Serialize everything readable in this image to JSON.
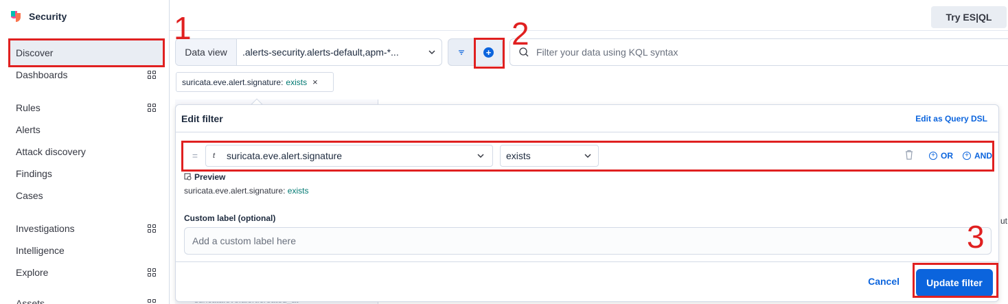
{
  "app": {
    "title": "Security"
  },
  "topbar": {
    "try_esql": "Try ES|QL"
  },
  "sidebar": {
    "items": [
      {
        "label": "Discover",
        "has_grid": false
      },
      {
        "label": "Dashboards",
        "has_grid": true
      },
      {
        "label": "Rules",
        "has_grid": true
      },
      {
        "label": "Alerts",
        "has_grid": false
      },
      {
        "label": "Attack discovery",
        "has_grid": false
      },
      {
        "label": "Findings",
        "has_grid": false
      },
      {
        "label": "Cases",
        "has_grid": false
      },
      {
        "label": "Investigations",
        "has_grid": true
      },
      {
        "label": "Intelligence",
        "has_grid": false
      },
      {
        "label": "Explore",
        "has_grid": true
      },
      {
        "label": "Assets",
        "has_grid": true
      }
    ]
  },
  "query_bar": {
    "data_view_label": "Data view",
    "data_view_value": ".alerts-security.alerts-default,apm-*...",
    "kql_placeholder": "Filter your data using KQL syntax"
  },
  "filter_pill": {
    "field": "suricata.eve.alert.signature:",
    "operator": "exists"
  },
  "edit_filter": {
    "title": "Edit filter",
    "edit_dsl": "Edit as Query DSL",
    "field_type": "t",
    "field": "suricata.eve.alert.signature",
    "operator": "exists",
    "or_label": "OR",
    "and_label": "AND",
    "preview_title": "Preview",
    "preview_field": "suricata.eve.alert.signature:",
    "preview_operator": "exists",
    "custom_label_caption": "Custom label (optional)",
    "custom_label_placeholder": "Add a custom label here",
    "cancel": "Cancel",
    "update": "Update filter"
  },
  "background": {
    "partial_field": "suricata.eve.alert.created_at",
    "partial_right": "ut"
  },
  "annotations": [
    "1",
    "2",
    "3"
  ],
  "colors": {
    "accent": "#0b64dd",
    "annotation": "#e02020",
    "exists": "#007871"
  }
}
